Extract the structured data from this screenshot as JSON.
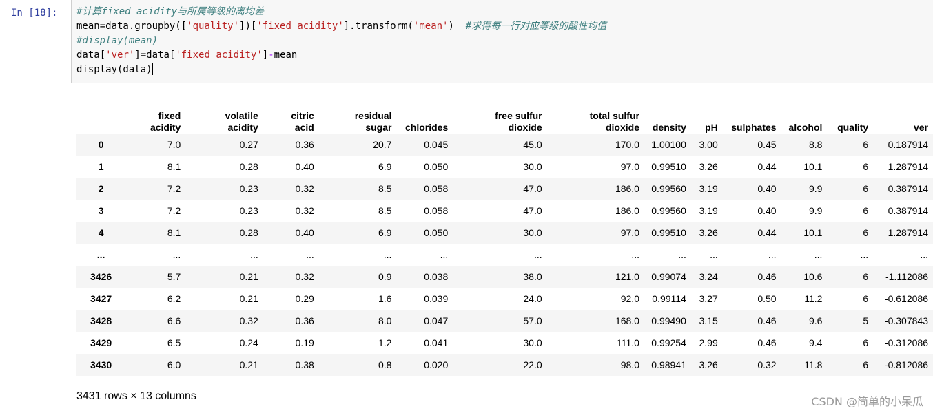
{
  "cell": {
    "prompt": "In  [18]:",
    "code": {
      "line1_comment": "#计算fixed acidity与所属等级的离均差",
      "line2_a": "mean=data.groupby([",
      "line2_s1": "'quality'",
      "line2_b": "])[",
      "line2_s2": "'fixed acidity'",
      "line2_c": "].transform(",
      "line2_s3": "'mean'",
      "line2_d": ")  ",
      "line2_comment": "#求得每一行对应等级的酸性均值",
      "line3_comment": "#display(mean)",
      "line4_a": "data[",
      "line4_s1": "'ver'",
      "line4_b": "]=data[",
      "line4_s2": "'fixed acidity'",
      "line4_c": "]",
      "line4_op": "-",
      "line4_d": "mean",
      "line5": "display(data)"
    }
  },
  "table": {
    "columns": [
      [
        "fixed",
        "acidity"
      ],
      [
        "volatile",
        "acidity"
      ],
      [
        "citric",
        "acid"
      ],
      [
        "residual",
        "sugar"
      ],
      [
        "",
        "chlorides"
      ],
      [
        "free sulfur",
        "dioxide"
      ],
      [
        "total sulfur",
        "dioxide"
      ],
      [
        "",
        "density"
      ],
      [
        "",
        "pH"
      ],
      [
        "",
        "sulphates"
      ],
      [
        "",
        "alcohol"
      ],
      [
        "",
        "quality"
      ],
      [
        "",
        "ver"
      ]
    ],
    "rows": [
      {
        "index": "0",
        "cells": [
          "7.0",
          "0.27",
          "0.36",
          "20.7",
          "0.045",
          "45.0",
          "170.0",
          "1.00100",
          "3.00",
          "0.45",
          "8.8",
          "6",
          "0.187914"
        ]
      },
      {
        "index": "1",
        "cells": [
          "8.1",
          "0.28",
          "0.40",
          "6.9",
          "0.050",
          "30.0",
          "97.0",
          "0.99510",
          "3.26",
          "0.44",
          "10.1",
          "6",
          "1.287914"
        ]
      },
      {
        "index": "2",
        "cells": [
          "7.2",
          "0.23",
          "0.32",
          "8.5",
          "0.058",
          "47.0",
          "186.0",
          "0.99560",
          "3.19",
          "0.40",
          "9.9",
          "6",
          "0.387914"
        ]
      },
      {
        "index": "3",
        "cells": [
          "7.2",
          "0.23",
          "0.32",
          "8.5",
          "0.058",
          "47.0",
          "186.0",
          "0.99560",
          "3.19",
          "0.40",
          "9.9",
          "6",
          "0.387914"
        ]
      },
      {
        "index": "4",
        "cells": [
          "8.1",
          "0.28",
          "0.40",
          "6.9",
          "0.050",
          "30.0",
          "97.0",
          "0.99510",
          "3.26",
          "0.44",
          "10.1",
          "6",
          "1.287914"
        ]
      },
      {
        "index": "...",
        "cells": [
          "...",
          "...",
          "...",
          "...",
          "...",
          "...",
          "...",
          "...",
          "...",
          "...",
          "...",
          "...",
          "..."
        ]
      },
      {
        "index": "3426",
        "cells": [
          "5.7",
          "0.21",
          "0.32",
          "0.9",
          "0.038",
          "38.0",
          "121.0",
          "0.99074",
          "3.24",
          "0.46",
          "10.6",
          "6",
          "-1.112086"
        ]
      },
      {
        "index": "3427",
        "cells": [
          "6.2",
          "0.21",
          "0.29",
          "1.6",
          "0.039",
          "24.0",
          "92.0",
          "0.99114",
          "3.27",
          "0.50",
          "11.2",
          "6",
          "-0.612086"
        ]
      },
      {
        "index": "3428",
        "cells": [
          "6.6",
          "0.32",
          "0.36",
          "8.0",
          "0.047",
          "57.0",
          "168.0",
          "0.99490",
          "3.15",
          "0.46",
          "9.6",
          "5",
          "-0.307843"
        ]
      },
      {
        "index": "3429",
        "cells": [
          "6.5",
          "0.24",
          "0.19",
          "1.2",
          "0.041",
          "30.0",
          "111.0",
          "0.99254",
          "2.99",
          "0.46",
          "9.4",
          "6",
          "-0.312086"
        ]
      },
      {
        "index": "3430",
        "cells": [
          "6.0",
          "0.21",
          "0.38",
          "0.8",
          "0.020",
          "22.0",
          "98.0",
          "0.98941",
          "3.26",
          "0.32",
          "11.8",
          "6",
          "-0.812086"
        ]
      }
    ]
  },
  "shape_text": "3431 rows × 13 columns",
  "watermark": "CSDN @简单的小呆瓜"
}
